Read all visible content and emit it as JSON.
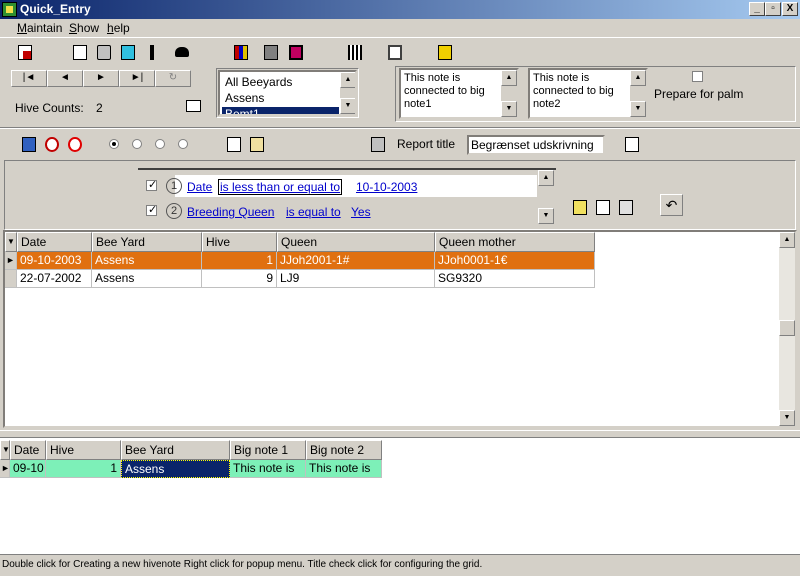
{
  "window": {
    "title": "Quick_Entry",
    "controls": [
      "_",
      "▫",
      "X"
    ]
  },
  "menu": [
    {
      "pre": "",
      "mn": "M",
      "post": "aintain"
    },
    {
      "pre": "",
      "mn": "S",
      "post": "how"
    },
    {
      "pre": "",
      "mn": "h",
      "post": "elp"
    }
  ],
  "nav": {
    "first": "|◄",
    "prev": "◄",
    "next": "►",
    "last": "►|",
    "refresh": "↻"
  },
  "hive_counts": {
    "label": "Hive Counts:",
    "value": "2"
  },
  "beeyards": {
    "items": [
      "All Beeyards",
      "Assens",
      "Bemt1"
    ],
    "selected_index": 2
  },
  "notes": {
    "note1": "This note is connected to big note1",
    "note2": "This note is connected to big note2"
  },
  "prepare_palm": {
    "label": "Prepare for palm",
    "checked": false
  },
  "report": {
    "title_label": "Report title",
    "title_value": "Begrænset udskrivning"
  },
  "filters": [
    {
      "checked": true,
      "num": "1",
      "field": "Date",
      "op": "is less than or equal to",
      "value": "10-10-2003"
    },
    {
      "checked": true,
      "num": "2",
      "field": "Breeding Queen",
      "op": "is equal to",
      "value": "Yes"
    }
  ],
  "main_grid": {
    "columns": [
      "Date",
      "Bee Yard",
      "Hive",
      "Queen",
      "Queen mother"
    ],
    "rows": [
      {
        "date": "09-10-2003",
        "beeyard": "Assens",
        "hive": "1",
        "queen": "JJoh2001-1#",
        "queen_mother": "JJoh0001-1€",
        "selected": true
      },
      {
        "date": "22-07-2002",
        "beeyard": "Assens",
        "hive": "9",
        "queen": "LJ9",
        "queen_mother": "SG9320",
        "selected": false
      }
    ]
  },
  "note_grid": {
    "columns": [
      "Date",
      "Hive",
      "Bee Yard",
      "Big note 1",
      "Big note 2"
    ],
    "rows": [
      {
        "date": "09-10",
        "hive": "1",
        "beeyard": "Assens",
        "big_note1": "This note is",
        "big_note2": "This note is"
      }
    ]
  },
  "status_text": "Double click for Creating a new hivenote  Right click for popup menu.  Title check click for configuring the grid.",
  "colors": {
    "selected_row": "#e07010",
    "note_row": "#7df0b8",
    "title_dark": "#0a246a",
    "title_light": "#a6caf0"
  }
}
